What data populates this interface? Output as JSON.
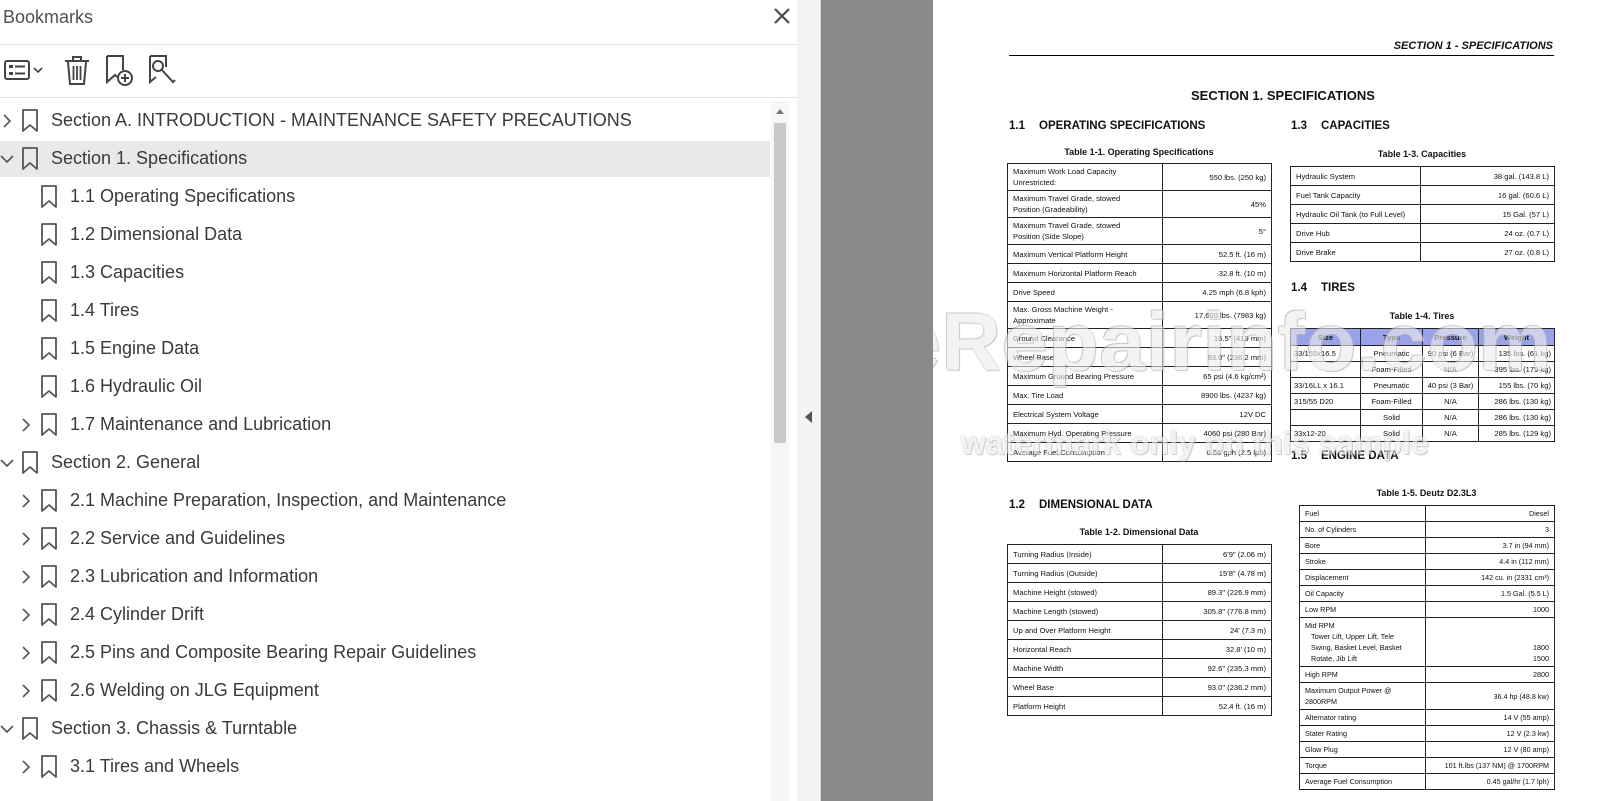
{
  "panel": {
    "title": "Bookmarks",
    "toolbar": [
      "options-menu",
      "delete-bookmark",
      "new-bookmark",
      "new-bookmark-from-structure"
    ]
  },
  "bookmarks": [
    {
      "label": "Section A. INTRODUCTION - MAINTENANCE SAFETY PRECAUTIONS",
      "level": 0,
      "expander": "collapsed",
      "selected": false
    },
    {
      "label": "Section 1. Specifications",
      "level": 0,
      "expander": "expanded",
      "selected": true
    },
    {
      "label": "1.1 Operating Specifications",
      "level": 1,
      "expander": "none",
      "selected": false
    },
    {
      "label": "1.2 Dimensional Data",
      "level": 1,
      "expander": "none",
      "selected": false
    },
    {
      "label": "1.3 Capacities",
      "level": 1,
      "expander": "none",
      "selected": false
    },
    {
      "label": "1.4 Tires",
      "level": 1,
      "expander": "none",
      "selected": false
    },
    {
      "label": "1.5 Engine Data",
      "level": 1,
      "expander": "none",
      "selected": false
    },
    {
      "label": "1.6 Hydraulic Oil",
      "level": 1,
      "expander": "none",
      "selected": false
    },
    {
      "label": "1.7 Maintenance and Lubrication",
      "level": 1,
      "expander": "collapsed",
      "selected": false
    },
    {
      "label": "Section 2. General",
      "level": 0,
      "expander": "expanded",
      "selected": false
    },
    {
      "label": "2.1 Machine Preparation, Inspection, and Maintenance",
      "level": 1,
      "expander": "collapsed",
      "selected": false
    },
    {
      "label": "2.2 Service and Guidelines",
      "level": 1,
      "expander": "collapsed",
      "selected": false
    },
    {
      "label": "2.3 Lubrication and Information",
      "level": 1,
      "expander": "collapsed",
      "selected": false
    },
    {
      "label": "2.4 Cylinder Drift",
      "level": 1,
      "expander": "collapsed",
      "selected": false
    },
    {
      "label": "2.5 Pins and Composite Bearing Repair Guidelines",
      "level": 1,
      "expander": "collapsed",
      "selected": false
    },
    {
      "label": "2.6 Welding on JLG Equipment",
      "level": 1,
      "expander": "collapsed",
      "selected": false
    },
    {
      "label": "Section 3. Chassis & Turntable",
      "level": 0,
      "expander": "expanded",
      "selected": false
    },
    {
      "label": "3.1 Tires and Wheels",
      "level": 1,
      "expander": "collapsed",
      "selected": false
    }
  ],
  "document": {
    "running_head": "SECTION 1 - SPECIFICATIONS",
    "section_title": "SECTION 1.  SPECIFICATIONS",
    "s11": {
      "num": "1.1",
      "title": "OPERATING SPECIFICATIONS",
      "caption": "Table 1-1. Operating Specifications",
      "rows": [
        [
          "Maximum Work Load Capacity\nUnrestricted:",
          "550 lbs. (250 kg)"
        ],
        [
          "Maximum Travel Grade, stowed\nPosition (Gradeability)",
          "45%"
        ],
        [
          "Maximum Travel Grade, stowed\nPosition (Side Slope)",
          "5°"
        ],
        [
          "Maximum Vertical Platform Height",
          "52.5 ft. (16 m)"
        ],
        [
          "Maximum Horizontal Platform Reach",
          "32.8 ft. (10 m)"
        ],
        [
          "Drive Speed",
          "4.25 mph (6.8 kph)"
        ],
        [
          "Max. Gross Machine Weight - Approximate",
          "17,600 lbs. (7983 kg)"
        ],
        [
          "Ground Clearance",
          "16.5\" (419 mm)"
        ],
        [
          "Wheel Base",
          "93.0\" (236.2 mm)"
        ],
        [
          "Maximum Ground Bearing Pressure",
          "65 psi (4.6 kg/cm²)"
        ],
        [
          "Max. Tire Load",
          "8900 lbs. (4237 kg)"
        ],
        [
          "Electrical System Voltage",
          "12V DC"
        ],
        [
          "Maximum Hyd. Operating Pressure",
          "4060 psi (280 Bar)"
        ],
        [
          "Average Fuel Consumption",
          "0.66 gph (2.5 lph)"
        ]
      ]
    },
    "s12": {
      "num": "1.2",
      "title": "DIMENSIONAL DATA",
      "caption": "Table 1-2. Dimensional Data",
      "rows": [
        [
          "Turning Radius (Inside)",
          "6'9\" (2.06 m)"
        ],
        [
          "Turning Radius (Outside)",
          "15'8\" (4.78 m)"
        ],
        [
          "Machine Height (stowed)",
          "89.3\" (226.9 mm)"
        ],
        [
          "Machine Length (stowed)",
          "305.8\" (776.8 mm)"
        ],
        [
          "Up and Over Platform Height",
          "24' (7.3 m)"
        ],
        [
          "Horizontal Reach",
          "32.8' (10 m)"
        ],
        [
          "Machine Width",
          "92.6\" (235.3 mm)"
        ],
        [
          "Wheel Base",
          "93.0\" (236.2 mm)"
        ],
        [
          "Platform Height",
          "52.4 ft. (16 m)"
        ]
      ]
    },
    "s13": {
      "num": "1.3",
      "title": "CAPACITIES",
      "caption": "Table 1-3. Capacities",
      "rows": [
        [
          "Hydraulic System",
          "38 gal. (143.8 L)"
        ],
        [
          "Fuel Tank Capacity",
          "16 gal. (60.6 L)"
        ],
        [
          "Hydraulic Oil Tank (to Full Level)",
          "15 Gal. (57 L)"
        ],
        [
          "Drive Hub",
          "24 oz. (0.7 L)"
        ],
        [
          "Drive Brake",
          "27 oz. (0.8 L)"
        ]
      ]
    },
    "s14": {
      "num": "1.4",
      "title": "TIRES",
      "caption": "Table 1-4. Tires",
      "headers": [
        "Size",
        "Type",
        "Pressure",
        "Weight"
      ],
      "rows": [
        [
          "33/155x16.5",
          "Pneumatic",
          "90 psi (6 Bar)",
          "135 lbs. (61 kg)"
        ],
        [
          "",
          "Foam-Filled",
          "N/A",
          "395 lbs. (179 kg)"
        ],
        [
          "33/16LL x 16.1",
          "Pneumatic",
          "40 psi (3 Bar)",
          "155 lbs. (70 kg)"
        ],
        [
          "315/55 D20",
          "Foam-Filled",
          "N/A",
          "286 lbs. (130 kg)"
        ],
        [
          "",
          "Solid",
          "N/A",
          "286 lbs. (130 kg)"
        ],
        [
          "33x12-20",
          "Solid",
          "N/A",
          "285 lbs. (129 kg)"
        ]
      ]
    },
    "s15": {
      "num": "1.5",
      "title": "ENGINE DATA",
      "caption": "Table 1-5. Deutz D2.3L3",
      "rows": [
        [
          "Fuel",
          "Diesel"
        ],
        [
          "No. of Cylinders",
          "3"
        ],
        [
          "Bore",
          "3.7 in (94 mm)"
        ],
        [
          "Stroke",
          "4.4 in (112 mm)"
        ],
        [
          "Displacement",
          "142 cu. in (2331 cm³)"
        ],
        [
          "Oil Capacity",
          "1.5 Gal. (5.5 L)"
        ],
        [
          "Low RPM",
          "1000"
        ],
        [
          "High RPM",
          "2800"
        ],
        [
          "Maximum Output Power @ 2800RPM",
          "36.4 hp (48.8 kw)"
        ],
        [
          "Alternator rating",
          "14 V (55 amp)"
        ],
        [
          "Stater Rating",
          "12 V (2.3 kw)"
        ],
        [
          "Glow Plug",
          "12 V (80 amp)"
        ],
        [
          "Torque",
          "101 ft.lbs (137 NM) @ 1700RPM"
        ],
        [
          "Average Fuel Consumption",
          "0.45 gal/hr (1.7 lph)"
        ]
      ],
      "mid_rpm": {
        "label": "Mid RPM",
        "lines": [
          "Tower Lift, Upper Lift, Tele",
          "Swing, Basket Level, Basket",
          "Rotate, Jib Lift"
        ],
        "values": [
          "1800",
          "1500"
        ]
      }
    },
    "watermark": {
      "line1": "eRepairinfo.com",
      "line2": "watermark only on this sample"
    }
  }
}
